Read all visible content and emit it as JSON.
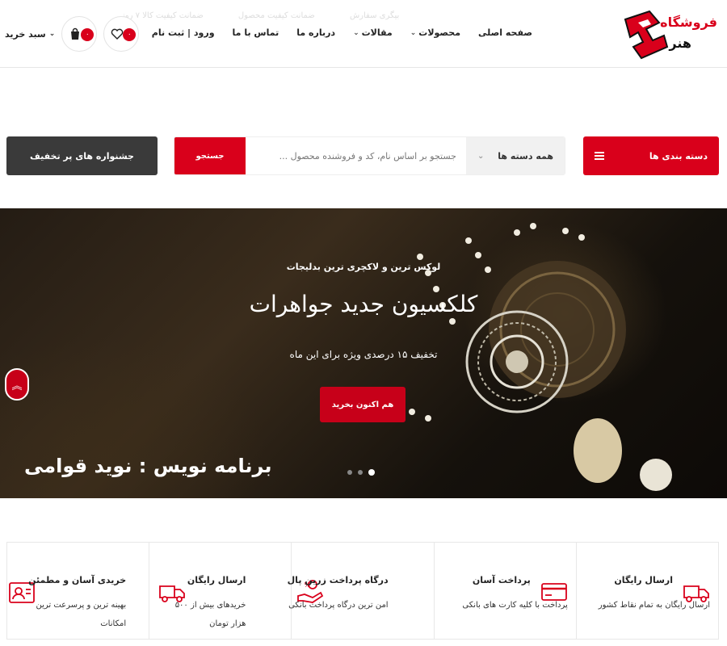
{
  "brand": {
    "logo_text_line1": "فروشگاه",
    "logo_text_line2": "هنر",
    "colors": {
      "accent": "#d9001b",
      "dark": "#3a3a3a"
    }
  },
  "header": {
    "nav": [
      {
        "label": "صفحه اصلی",
        "dropdown": false
      },
      {
        "label": "محصولات",
        "dropdown": true
      },
      {
        "label": "مقالات",
        "dropdown": true
      },
      {
        "label": "درباره ما",
        "dropdown": false
      },
      {
        "label": "تماس با ما",
        "dropdown": false
      },
      {
        "label": "ورود | ثبت نام",
        "dropdown": false
      }
    ],
    "ticker": [
      "بیگری سفارش",
      "ضمانت کیفیت محصول",
      "ضمانت کیفیت کالا ۷ روز"
    ],
    "wishlist": {
      "icon": "heart-icon",
      "count": "۰"
    },
    "cart": {
      "icon": "shopping-bag-icon",
      "count": "۰",
      "label": "سبد خرید"
    }
  },
  "search": {
    "categories_button": "دسته بندی ها",
    "category_select": "همه دسته ها",
    "placeholder": "جستجو بر اساس نام، کد و فروشنده محصول ...",
    "submit": "جستجو",
    "deals_button": "جشنواره های پر تخفیف"
  },
  "hero": {
    "subtitle": "لوکس ترین و لاکچری ترین بدلیجات",
    "title": "کلکسیون جدید جواهرات",
    "description": "تخفیف ۱۵ درصدی ویژه برای این ماه",
    "cta": "هم اکنون بخرید",
    "credit": "برنامه نویس : نوید قوامی",
    "slides": 3,
    "active_slide": 1
  },
  "features": [
    {
      "icon": "truck-icon",
      "title": "ارسال رایگان",
      "desc": "ارسال رایگان به تمام نقاط کشور"
    },
    {
      "icon": "credit-card-icon",
      "title": "پرداخت آسان",
      "desc": "پرداخت با کلیه کارت های بانکی"
    },
    {
      "icon": "payment-hand-icon",
      "title": "درگاه پرداخت زرین پال",
      "desc": "امن ترین درگاه پرداخت بانکی"
    },
    {
      "icon": "truck-icon",
      "title": "ارسال رایگان",
      "desc": "خریدهای بیش از ۵۰۰ هزار تومان"
    },
    {
      "icon": "id-card-icon",
      "title": "خریدی آسان و مطمئن",
      "desc": "بهینه ترین و پرسرعت ترین امکانات"
    }
  ]
}
